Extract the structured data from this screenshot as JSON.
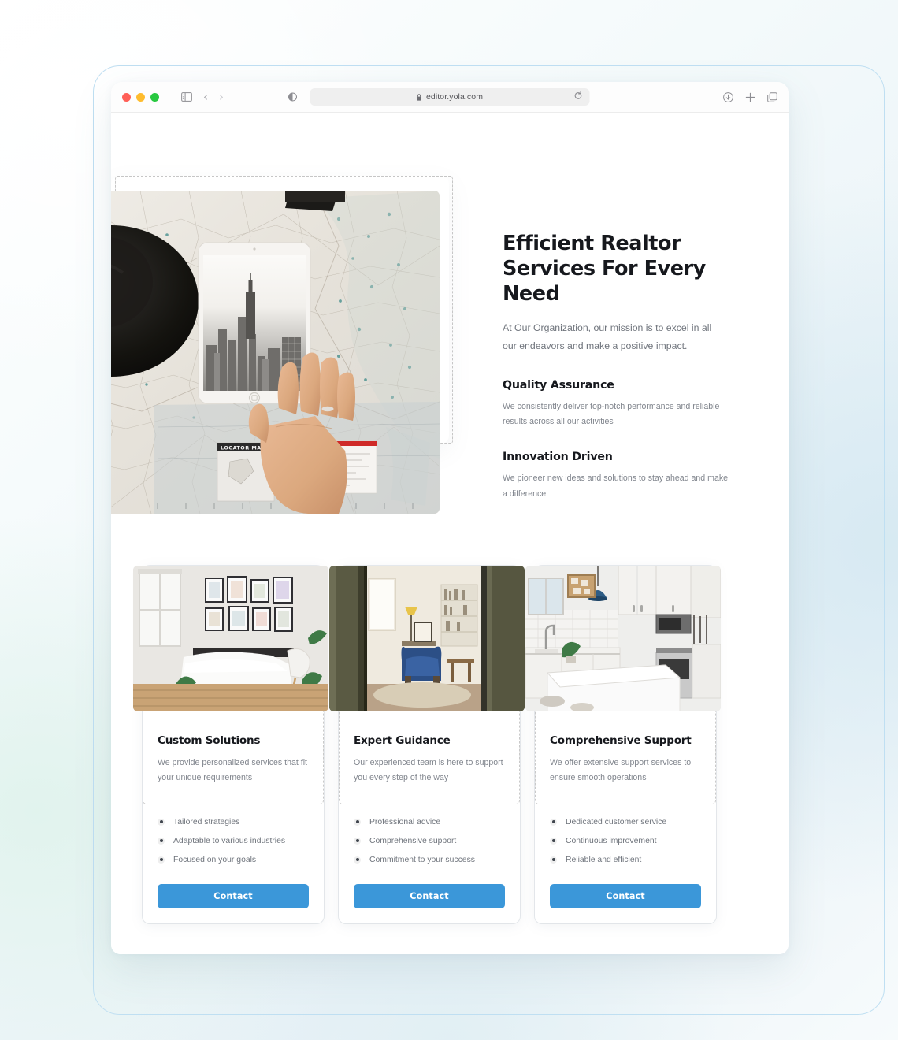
{
  "browser": {
    "traffic_lights": [
      "close",
      "minimize",
      "zoom"
    ],
    "sidebar_icon": "sidebar-icon",
    "back_label": "‹",
    "forward_label": "›",
    "reader_icon": "reader-view-icon",
    "url": "editor.yola.com",
    "lock_icon": "lock-icon",
    "reload_icon": "reload-icon",
    "download_icon": "download-icon",
    "new_tab_icon": "plus-icon",
    "tab_overview_icon": "tab-overview-icon"
  },
  "hero": {
    "image_name": "tablet-on-map-photo",
    "title": "Efficient Realtor Services For Every Need",
    "subtitle": "At Our Organization, our mission is to excel in all our endeavors and make a positive impact.",
    "features": [
      {
        "title": "Quality Assurance",
        "body": "We consistently deliver top-notch performance and reliable results across all our activities"
      },
      {
        "title": "Innovation Driven",
        "body": "We pioneer new ideas and solutions to stay ahead and make a difference"
      }
    ]
  },
  "cards": [
    {
      "image_name": "bedroom-photo",
      "title": "Custom Solutions",
      "desc": "We provide personalized services that fit your unique requirements",
      "items": [
        "Tailored strategies",
        "Adaptable to various industries",
        "Focused on your goals"
      ],
      "button": "Contact"
    },
    {
      "image_name": "living-room-photo",
      "title": "Expert Guidance",
      "desc": "Our experienced team is here to support you every step of the way",
      "items": [
        "Professional advice",
        "Comprehensive support",
        "Commitment to your success"
      ],
      "button": "Contact"
    },
    {
      "image_name": "kitchen-photo",
      "title": "Comprehensive Support",
      "desc": "We offer extensive support services to ensure smooth operations",
      "items": [
        "Dedicated customer service",
        "Continuous improvement",
        "Reliable and efficient"
      ],
      "button": "Contact"
    }
  ],
  "colors": {
    "accent": "#3b97d9",
    "heading": "#16181d",
    "body_text": "#80858d",
    "frame_outline": "#bfdff2",
    "selection_dash": "#c6c6c6"
  }
}
